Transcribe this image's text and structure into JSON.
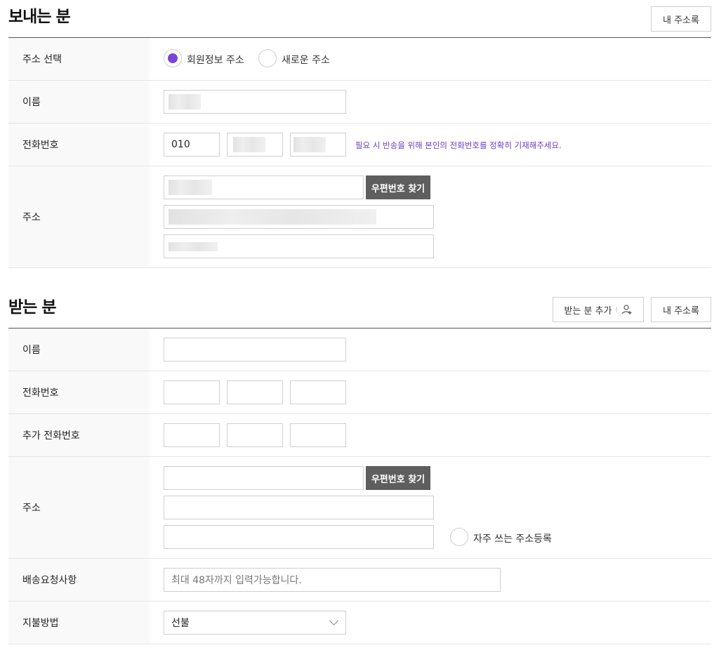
{
  "sender": {
    "title": "보내는 분",
    "address_book_button": "내 주소록",
    "address_select": {
      "label": "주소 선택",
      "options": [
        {
          "label": "회원정보 주소",
          "checked": true
        },
        {
          "label": "새로운 주소",
          "checked": false
        }
      ]
    },
    "name": {
      "label": "이름"
    },
    "phone": {
      "label": "전화번호",
      "prefix": "010",
      "note": "필요 시 반송을 위해 본인의 전화번호를 정확히 기재해주세요."
    },
    "address": {
      "label": "주소",
      "zipcode_button": "우편번호 찾기"
    }
  },
  "receiver": {
    "title": "받는 분",
    "add_button": "받는 분 추가",
    "address_book_button": "내 주소록",
    "name": {
      "label": "이름"
    },
    "phone": {
      "label": "전화번호"
    },
    "extra_phone": {
      "label": "추가 전화번호"
    },
    "address": {
      "label": "주소",
      "zipcode_button": "우편번호 찾기",
      "favorite_label": "자주 쓰는 주소등록"
    },
    "request": {
      "label": "배송요청사항",
      "placeholder": "최대 48자까지 입력가능합니다."
    },
    "payment": {
      "label": "지불방법",
      "selected": "선불"
    }
  },
  "colors": {
    "accent": "#7b45d8",
    "note": "#6a3fc4",
    "dark_button": "#5e5e5e"
  }
}
